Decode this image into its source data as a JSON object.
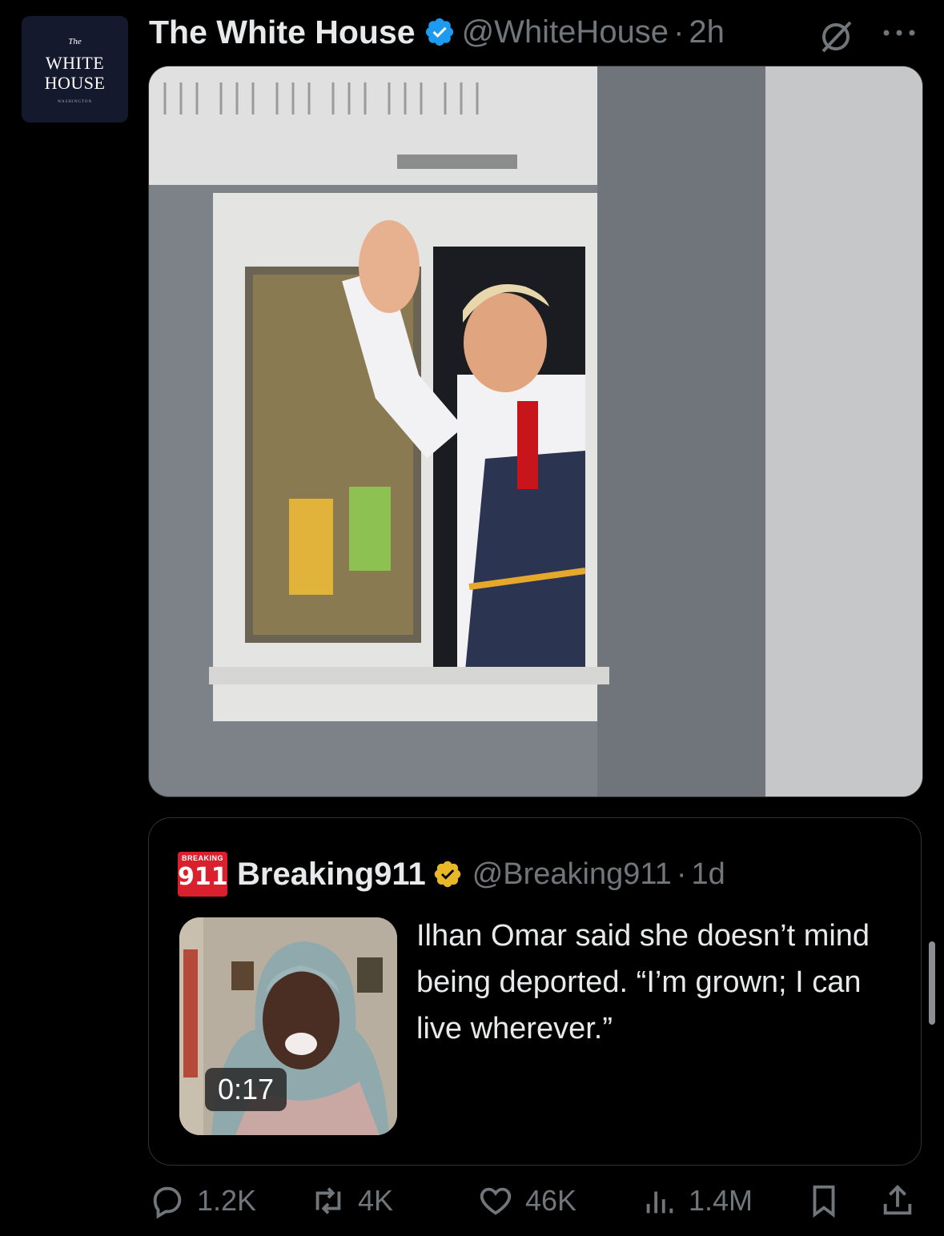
{
  "post": {
    "avatar": {
      "line1": "The",
      "line2": "WHITE",
      "line3": "HOUSE",
      "line4": "WASHINGTON"
    },
    "author_name": "The White House",
    "handle": "@WhiteHouse",
    "separator": "·",
    "time": "2h",
    "media_description_icon": "photo",
    "icons": {
      "grok": "grok-icon",
      "more": "more-icon",
      "verified": "verified-badge-icon"
    }
  },
  "quote": {
    "logo": {
      "small": "BREAKING",
      "big": "911"
    },
    "author_name": "Breaking911",
    "handle": "@Breaking911",
    "separator": "·",
    "time": "1d",
    "video_duration": "0:17",
    "text": "Ilhan Omar said she doesn’t mind being deported. “I’m grown; I can live wherever.”"
  },
  "actions": {
    "replies": "1.2K",
    "reposts": "4K",
    "likes": "46K",
    "views": "1.4M"
  },
  "colors": {
    "background": "#000000",
    "text": "#e7e9ea",
    "muted": "#71767b",
    "verified_blue": "#1d9bf0",
    "verified_gold": "#e8b829",
    "border": "#2f3336"
  }
}
